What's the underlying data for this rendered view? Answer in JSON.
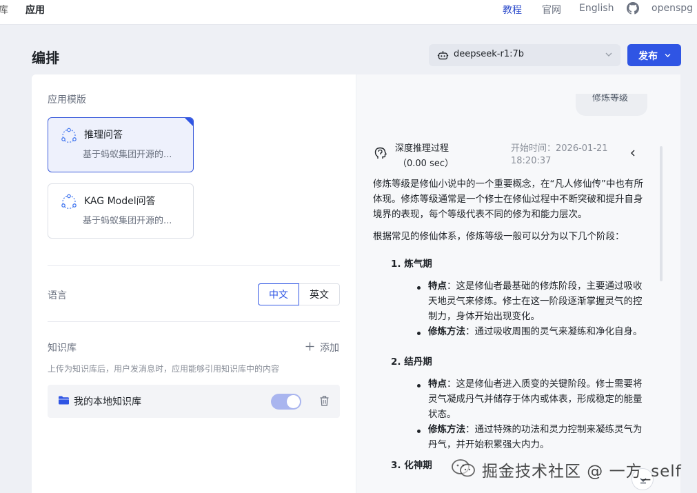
{
  "topnav": {
    "partial_item": "库",
    "app_label": "应用",
    "links": [
      "教程",
      "官网",
      "English"
    ],
    "active_link": "教程",
    "github_user": "openspg"
  },
  "header": {
    "title": "编排",
    "model": "deepseek-r1:7b",
    "publish_label": "发布"
  },
  "left": {
    "templates_label": "应用模版",
    "templates": [
      {
        "title": "推理问答",
        "desc": "基于蚂蚁集团开源的...",
        "selected": true
      },
      {
        "title": "KAG Model问答",
        "desc": "基于蚂蚁集团开源的...",
        "selected": false
      }
    ],
    "language_label": "语言",
    "language_options": [
      "中文",
      "英文"
    ],
    "language_selected": "中文",
    "kb_label": "知识库",
    "add_label": "添加",
    "kb_hint": "上传为知识库后，用户发消息时，应用能够引用知识库中的内容",
    "kb_items": [
      {
        "name": "我的本地知识库",
        "enabled": true
      }
    ]
  },
  "right": {
    "question_chip": "修炼等级",
    "think_title": "深度推理过程",
    "think_duration": "（0.00 sec）",
    "think_start_1": "开始时间：2026-01-21",
    "think_start_2": "18:20:37",
    "intro_1": "修炼等级是修仙小说中的一个重要概念，在“凡人修仙传”中也有所体现。修炼等级通常是一个修士在修仙过程中不断突破和提升自身境界的表现，每个等级代表不同的修为和能力层次。",
    "intro_2": "根据常见的修仙体系，修炼等级一般可以分为以下几个阶段：",
    "stages": [
      {
        "heading": "1. 炼气期",
        "bullets": [
          {
            "label": "特点",
            "text": "：这是修仙者最基础的修炼阶段，主要通过吸收天地灵气来修炼。修士在这一阶段逐渐掌握灵气的控制力，身体开始出现变化。"
          },
          {
            "label": "修炼方法",
            "text": "：通过吸收周围的灵气来凝练和净化自身。"
          }
        ]
      },
      {
        "heading": "2. 结丹期",
        "bullets": [
          {
            "label": "特点",
            "text": "：这是修仙者进入质变的关键阶段。修士需要将灵气凝成丹气并储存于体内或体表，形成稳定的能量状态。"
          },
          {
            "label": "修炼方法",
            "text": "：通过特殊的功法和灵力控制来凝练灵气为丹气，并开始积累强大内力。"
          }
        ]
      },
      {
        "heading": "3. 化神期",
        "bullets": []
      }
    ]
  },
  "watermark": "掘金技术社区 @ 一方_self",
  "colors": {
    "primary": "#2f55e4",
    "panel_bg": "#f7f8fa",
    "page_bg": "#eef0f5"
  }
}
